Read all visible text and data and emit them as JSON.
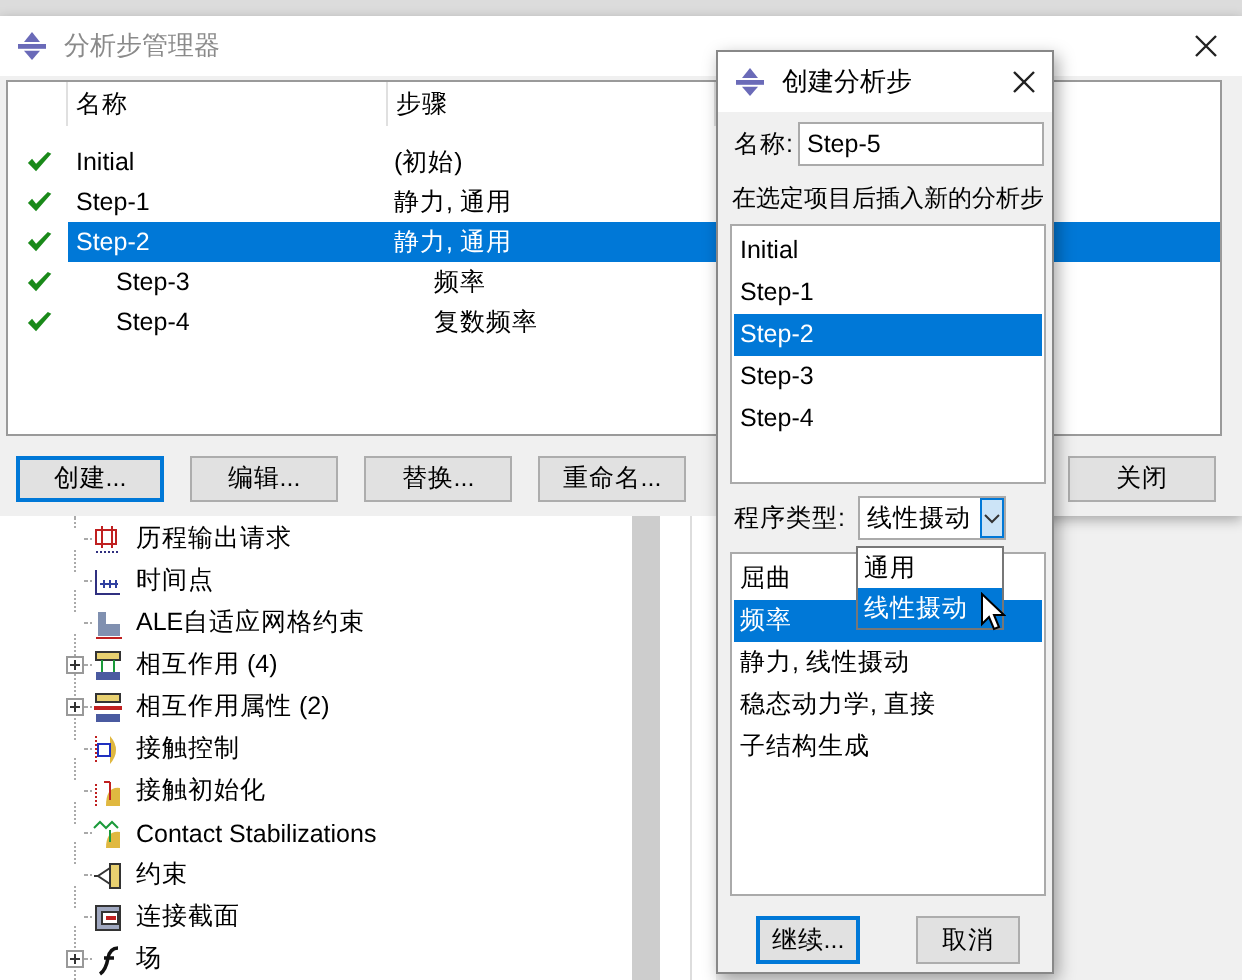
{
  "manager": {
    "title": "分析步管理器",
    "columns": [
      "名称",
      "步骤"
    ],
    "rows": [
      {
        "name": "Initial",
        "procedure": "(初始)",
        "checked": true,
        "selected": false
      },
      {
        "name": "Step-1",
        "procedure": "静力, 通用",
        "checked": true,
        "selected": false
      },
      {
        "name": "Step-2",
        "procedure": "静力, 通用",
        "checked": true,
        "selected": true,
        "children": [
          {
            "name": "Step-3",
            "procedure": "频率",
            "checked": true,
            "selected": false
          },
          {
            "name": "Step-4",
            "procedure": "复数频率",
            "checked": true,
            "selected": false
          }
        ]
      }
    ],
    "buttons": [
      {
        "label": "创建...",
        "focused": true
      },
      {
        "label": "编辑...",
        "focused": false
      },
      {
        "label": "替换...",
        "focused": false
      },
      {
        "label": "重命名...",
        "focused": false
      },
      {
        "label": "关闭",
        "focused": false
      }
    ]
  },
  "model_tree": {
    "items": [
      {
        "label": "历程输出请求",
        "kind": "history-output",
        "expandable": false
      },
      {
        "label": "时间点",
        "kind": "time-points",
        "expandable": false
      },
      {
        "label": "ALE自适应网格约束",
        "kind": "ale",
        "expandable": false
      },
      {
        "label": "相互作用 (4)",
        "kind": "interaction",
        "expandable": true
      },
      {
        "label": "相互作用属性 (2)",
        "kind": "interaction-property",
        "expandable": true
      },
      {
        "label": "接触控制",
        "kind": "contact-control",
        "expandable": false
      },
      {
        "label": "接触初始化",
        "kind": "contact-init",
        "expandable": false
      },
      {
        "label": "Contact Stabilizations",
        "kind": "contact-stab",
        "expandable": false
      },
      {
        "label": "约束",
        "kind": "constraint",
        "expandable": false
      },
      {
        "label": "连接截面",
        "kind": "connector-section",
        "expandable": false
      },
      {
        "label": "场",
        "kind": "field",
        "expandable": true
      }
    ]
  },
  "create_dialog": {
    "title": "创建分析步",
    "name_label": "名称:",
    "name_value": "Step-5",
    "insert_label": "在选定项目后插入新的分析步",
    "insert_after": [
      {
        "label": "Initial",
        "selected": false
      },
      {
        "label": "Step-1",
        "selected": false
      },
      {
        "label": "Step-2",
        "selected": true
      },
      {
        "label": "Step-3",
        "selected": false
      },
      {
        "label": "Step-4",
        "selected": false
      }
    ],
    "procedure_type_label": "程序类型:",
    "procedure_type_value": "线性摄动",
    "procedure_type_options": [
      {
        "label": "通用",
        "selected": false
      },
      {
        "label": "线性摄动",
        "selected": true
      }
    ],
    "procedures": [
      {
        "label": "屈曲",
        "selected": false
      },
      {
        "label": "频率",
        "selected": true
      },
      {
        "label": "静力, 线性摄动",
        "selected": false
      },
      {
        "label": "稳态动力学, 直接",
        "selected": false
      },
      {
        "label": "子结构生成",
        "selected": false
      }
    ],
    "buttons": [
      {
        "label": "继续...",
        "focused": true
      },
      {
        "label": "取消",
        "focused": false
      }
    ]
  }
}
